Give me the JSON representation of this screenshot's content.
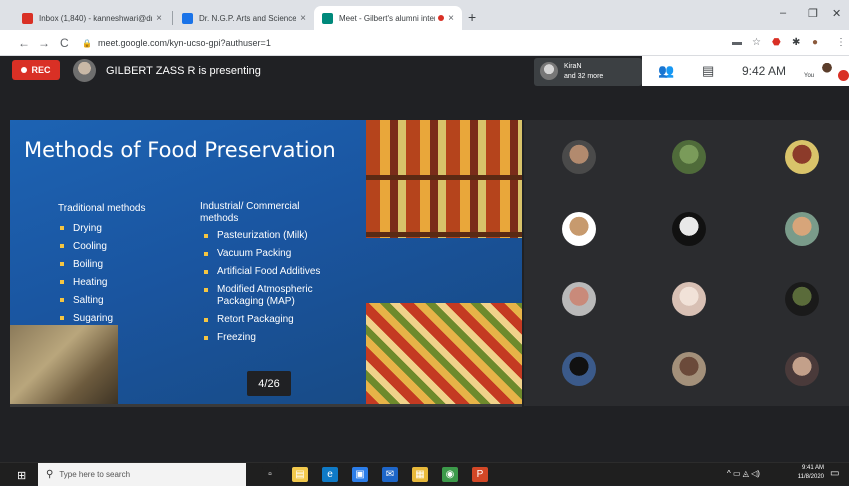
{
  "browser": {
    "tabs": [
      {
        "title": "Inbox (1,840) - kanneshwari@dr",
        "favicon_color": "#d93025",
        "active": false
      },
      {
        "title": "Dr. N.G.P. Arts and Science Colle",
        "favicon_color": "#1a73e8",
        "active": false
      },
      {
        "title": "Meet - Gilbert's alumni inter",
        "favicon_color": "#00897b",
        "active": true
      }
    ],
    "close_glyph": "×",
    "new_tab_glyph": "+",
    "window_controls": [
      "–",
      "❐",
      "✕"
    ],
    "nav": {
      "back": "←",
      "forward": "→",
      "reload": "C"
    },
    "url": "meet.google.com/kyn-ucso-gpi?authuser=1",
    "lock_glyph": "🔒",
    "extension_icons": [
      "cast-icon",
      "star-icon",
      "adblock-icon",
      "puzzle-icon",
      "profile-icon",
      "menu-dots-icon"
    ]
  },
  "meet": {
    "rec_label": "REC",
    "presenting_text": "GILBERT ZASS R is presenting",
    "participants_chip": {
      "line1": "KiraN",
      "line2": "and 32 more"
    },
    "time": "9:42 AM",
    "self_label": "You"
  },
  "slide": {
    "title": "Methods of Food Preservation",
    "traditional_heading": "Traditional methods",
    "traditional_items": [
      "Drying",
      "Cooling",
      "Boiling",
      "Heating",
      "Salting",
      "Sugaring"
    ],
    "industrial_heading": "Industrial/ Commercial methods",
    "industrial_items": [
      "Pasteurization (Milk)",
      "Vacuum Packing",
      "Artificial Food Additives",
      "Modified Atmospheric Packaging (MAP)",
      "Retort Packaging",
      "Freezing"
    ],
    "counter": "4/26"
  },
  "participant_tiles": [
    {
      "color": "#4a4a4a",
      "face": "#b28a6e"
    },
    {
      "color": "#4f6b3a",
      "face": "#7a9b5a"
    },
    {
      "color": "#d9c36a",
      "face": "#8c3b2a"
    },
    {
      "color": "#ffffff",
      "face": "#c79a6e"
    },
    {
      "color": "#111111",
      "face": "#e8e8e8"
    },
    {
      "color": "#7a9b8a",
      "face": "#d7a57a"
    },
    {
      "color": "#b9b9b9",
      "face": "#c98a7a"
    },
    {
      "color": "#d8c0b4",
      "face": "#f1e2d8"
    },
    {
      "color": "#1a1a1a",
      "face": "#5a6b3a"
    },
    {
      "color": "#3b5a8a",
      "face": "#111111"
    },
    {
      "color": "#a3907a",
      "face": "#6b4a3a"
    },
    {
      "color": "#4a3a3a",
      "face": "#c3a08a"
    }
  ],
  "taskbar": {
    "search_placeholder": "Type here to search",
    "time": "9:41 AM",
    "date": "11/8/2020",
    "apps": [
      {
        "name": "task-view-icon",
        "color": "#1f1f1f",
        "glyph": "▫"
      },
      {
        "name": "file-explorer-icon",
        "color": "#f2c94c",
        "glyph": "▤"
      },
      {
        "name": "edge-icon",
        "color": "#0f7ac6",
        "glyph": "e"
      },
      {
        "name": "store-icon",
        "color": "#2b7de9",
        "glyph": "▣"
      },
      {
        "name": "mail-icon",
        "color": "#1e66c8",
        "glyph": "✉"
      },
      {
        "name": "file-manager-icon",
        "color": "#e8b93a",
        "glyph": "▦"
      },
      {
        "name": "chrome-icon",
        "color": "#3c9a4a",
        "glyph": "◉"
      },
      {
        "name": "powerpoint-icon",
        "color": "#d24726",
        "glyph": "P"
      }
    ]
  }
}
